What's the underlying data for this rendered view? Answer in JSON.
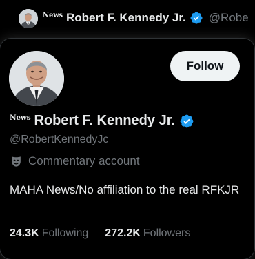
{
  "colors": {
    "background": "#000000",
    "text_primary": "#e7e9ea",
    "text_secondary": "#71767b",
    "verified_blue": "#1d9bf0",
    "follow_button_bg": "#eff3f4",
    "follow_button_text": "#0f1419"
  },
  "background_tweet": {
    "news_tag": "News",
    "display_name": "Robert F. Kennedy Jr.",
    "handle": "@Robe",
    "avatar_icon": "profile-photo",
    "verified_icon": "verified-badge-icon"
  },
  "hover_card": {
    "avatar_icon": "profile-photo",
    "follow_label": "Follow",
    "news_tag": "News",
    "display_name": "Robert F. Kennedy Jr.",
    "verified_icon": "verified-badge-icon",
    "handle": "@RobertKennedyJc",
    "account_label_icon": "theater-mask-icon",
    "account_label": "Commentary account",
    "bio": "MAHA News/No affiliation to the real RFKJR",
    "following_count": "24.3K",
    "following_label": "Following",
    "followers_count": "272.2K",
    "followers_label": "Followers"
  }
}
